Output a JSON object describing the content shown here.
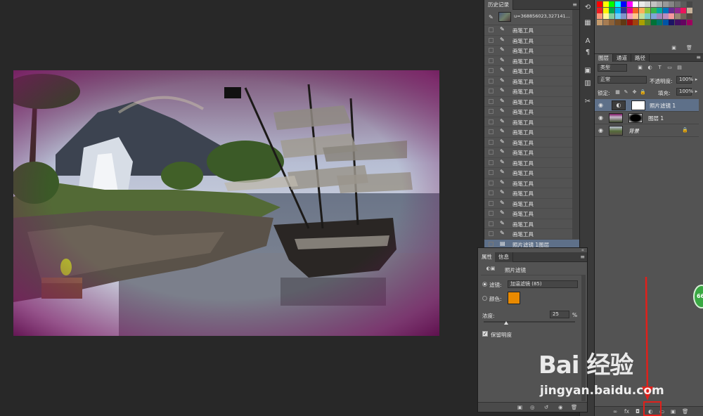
{
  "history": {
    "tab": "历史记录",
    "snapshot_label": "u=368856023,327141...",
    "items": [
      "画笔工具",
      "画笔工具",
      "画笔工具",
      "画笔工具",
      "画笔工具",
      "画笔工具",
      "画笔工具",
      "画笔工具",
      "画笔工具",
      "画笔工具",
      "画笔工具",
      "画笔工具",
      "画笔工具",
      "画笔工具",
      "画笔工具",
      "画笔工具",
      "画笔工具",
      "画笔工具",
      "画笔工具",
      "画笔工具",
      "画笔工具"
    ],
    "active_item": "照片滤镜 1图层"
  },
  "layers": {
    "tabs": [
      "图层",
      "通道",
      "路径"
    ],
    "kind_filter": "类型",
    "blend_mode": "正常",
    "opacity_label": "不透明度:",
    "opacity_value": "100%",
    "lock_label": "锁定:",
    "fill_label": "填充:",
    "fill_value": "100%",
    "items": [
      {
        "name": "照片滤镜 1",
        "active": true
      },
      {
        "name": "图层 1",
        "active": false
      },
      {
        "name": "背景",
        "active": false
      }
    ]
  },
  "properties": {
    "tabs": [
      "属性",
      "信息"
    ],
    "title": "照片滤镜",
    "filter_label": "滤镜:",
    "filter_value": "加温滤镜 (85)",
    "color_label": "颜色:",
    "color_value": "#e98a00",
    "density_label": "浓度:",
    "density_value": "25",
    "density_unit": "%",
    "preserve_label": "保留明度"
  },
  "watermark": {
    "main": "Bai 经验",
    "sub": "jingyan.baidu.com"
  },
  "badge": "66",
  "colors": {
    "panel": "#535353",
    "selection": "#5e7089",
    "highlight": "#e0201b"
  }
}
